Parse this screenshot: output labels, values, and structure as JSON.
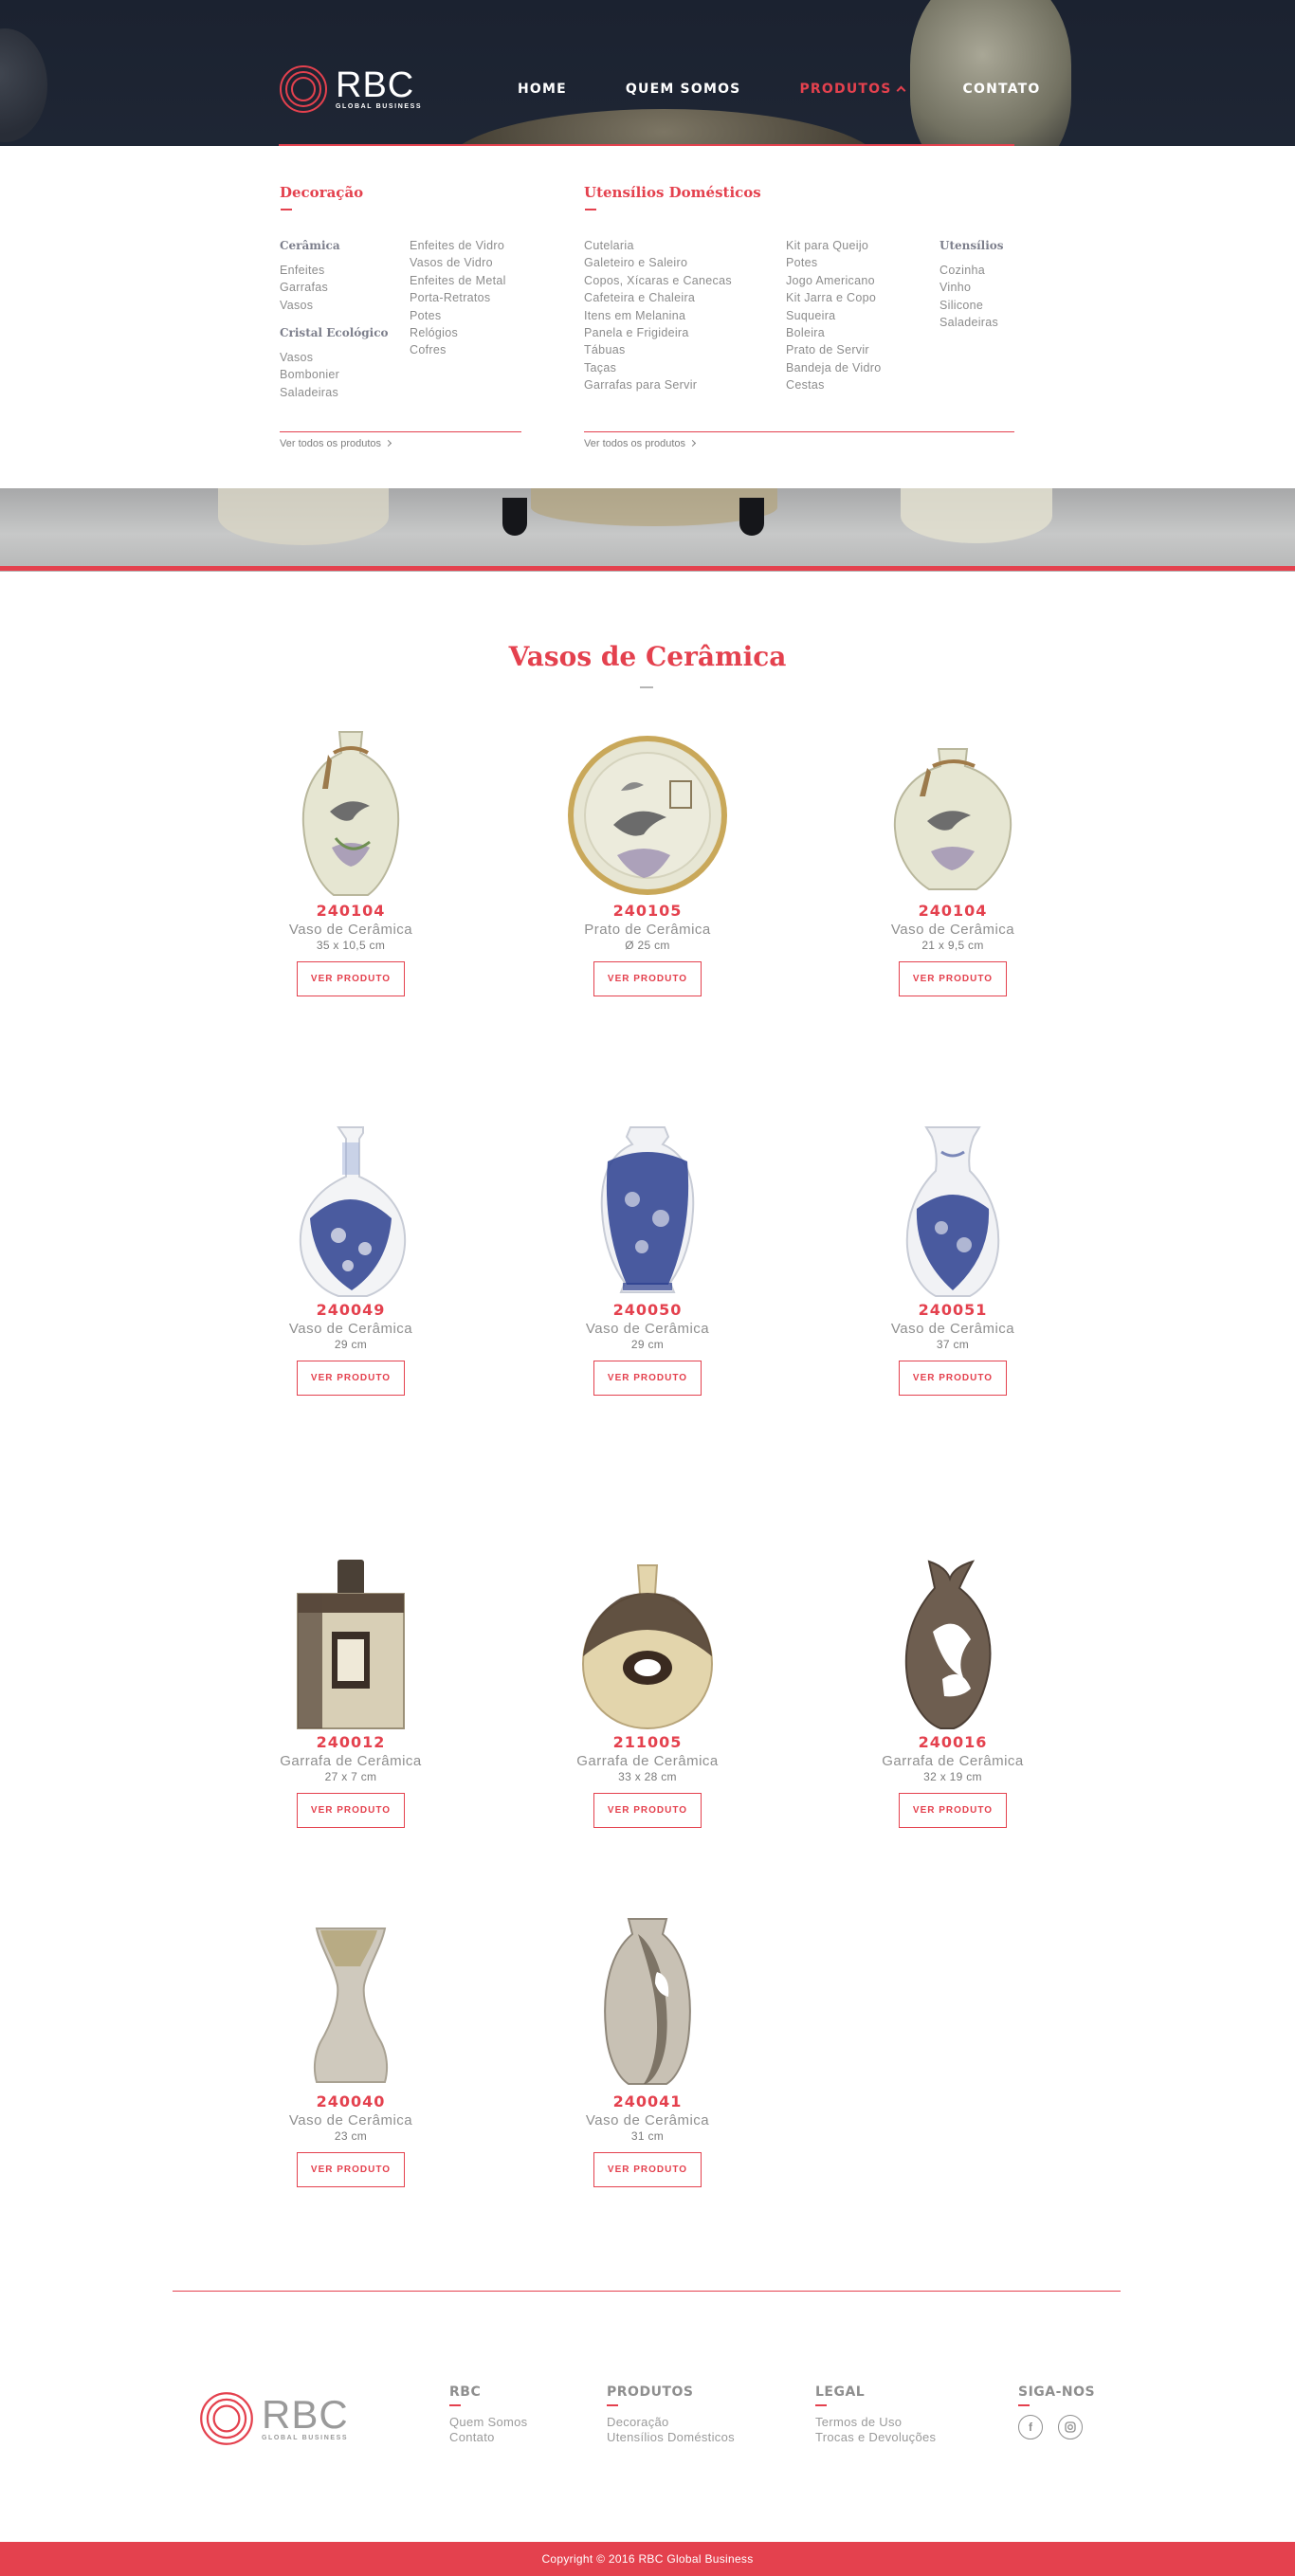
{
  "brand": {
    "name": "RBC",
    "tagline": "GLOBAL BUSINESS",
    "accent_color": "#e4414e",
    "header_bg": "#1b2230"
  },
  "nav": {
    "items": [
      {
        "label": "HOME"
      },
      {
        "label": "QUEM SOMOS"
      },
      {
        "label": "PRODUTOS",
        "active": true
      },
      {
        "label": "CONTATO"
      }
    ]
  },
  "mega_menu": {
    "decoracao": {
      "title": "Decoração",
      "ceramica": {
        "title": "Cerâmica",
        "items": [
          "Enfeites",
          "Garrafas",
          "Vasos"
        ]
      },
      "cristal": {
        "title": "Cristal Ecológico",
        "items": [
          "Vasos",
          "Bombonier",
          "Saladeiras"
        ]
      },
      "right_items": [
        "Enfeites de Vidro",
        "Vasos de Vidro",
        "Enfeites de Metal",
        "Porta-Retratos",
        "Potes",
        "Relógios",
        "Cofres"
      ],
      "see_all": "Ver todos os produtos"
    },
    "utensilios": {
      "title": "Utensílios Domésticos",
      "col1": [
        "Cutelaria",
        "Galeteiro e Saleiro",
        "Copos, Xícaras e Canecas",
        "Cafeteira e Chaleira",
        "Itens em Melanina",
        "Panela e Frigideira",
        "Tábuas",
        "Taças",
        "Garrafas para Servir"
      ],
      "col2": [
        "Kit para Queijo",
        "Potes",
        "Jogo Americano",
        "Kit Jarra e Copo",
        "Suqueira",
        "Boleira",
        "Prato de Servir",
        "Bandeja de Vidro",
        "Cestas"
      ],
      "col3_title": "Utensílios",
      "col3": [
        "Cozinha",
        "Vinho",
        "Silicone",
        "Saladeiras"
      ],
      "see_all": "Ver todos os produtos"
    }
  },
  "section": {
    "title": "Vasos de Cerâmica"
  },
  "products": [
    {
      "code": "240104",
      "name": "Vaso de Cerâmica",
      "size": "35 x 10,5 cm",
      "button": "VER PRODUTO",
      "icon": "bird-vase-icon"
    },
    {
      "code": "240105",
      "name": "Prato de Cerâmica",
      "size": "Ø 25 cm",
      "button": "VER PRODUTO",
      "icon": "bird-plate-icon"
    },
    {
      "code": "240104",
      "name": "Vaso de Cerâmica",
      "size": "21 x 9,5 cm",
      "button": "VER PRODUTO",
      "icon": "bird-vase-icon"
    },
    {
      "code": "240049",
      "name": "Vaso de Cerâmica",
      "size": "29 cm",
      "button": "VER PRODUTO",
      "icon": "blue-white-vase-icon"
    },
    {
      "code": "240050",
      "name": "Vaso de Cerâmica",
      "size": "29 cm",
      "button": "VER PRODUTO",
      "icon": "blue-white-vase-icon"
    },
    {
      "code": "240051",
      "name": "Vaso de Cerâmica",
      "size": "37 cm",
      "button": "VER PRODUTO",
      "icon": "blue-white-vase-icon"
    },
    {
      "code": "240012",
      "name": "Garrafa de Cerâmica",
      "size": "27 x 7 cm",
      "button": "VER PRODUTO",
      "icon": "square-bottle-icon"
    },
    {
      "code": "211005",
      "name": "Garrafa de Cerâmica",
      "size": "33 x 28 cm",
      "button": "VER PRODUTO",
      "icon": "round-bottle-icon"
    },
    {
      "code": "240016",
      "name": "Garrafa de Cerâmica",
      "size": "32 x 19 cm",
      "button": "VER PRODUTO",
      "icon": "sculpted-bottle-icon"
    },
    {
      "code": "240040",
      "name": "Vaso de Cerâmica",
      "size": "23 cm",
      "button": "VER PRODUTO",
      "icon": "hourglass-vase-icon"
    },
    {
      "code": "240041",
      "name": "Vaso de Cerâmica",
      "size": "31 cm",
      "button": "VER PRODUTO",
      "icon": "handle-vase-icon"
    }
  ],
  "footer": {
    "rbc": {
      "title": "RBC",
      "links": [
        "Quem Somos",
        "Contato"
      ]
    },
    "produtos": {
      "title": "PRODUTOS",
      "links": [
        "Decoração",
        "Utensílios Domésticos"
      ]
    },
    "legal": {
      "title": "LEGAL",
      "links": [
        "Termos de Uso",
        "Trocas e Devoluções"
      ]
    },
    "social": {
      "title": "SIGA-NOS",
      "icons": [
        "facebook-icon",
        "instagram-icon"
      ]
    },
    "copyright": "Copyright © 2016 RBC Global Business"
  }
}
